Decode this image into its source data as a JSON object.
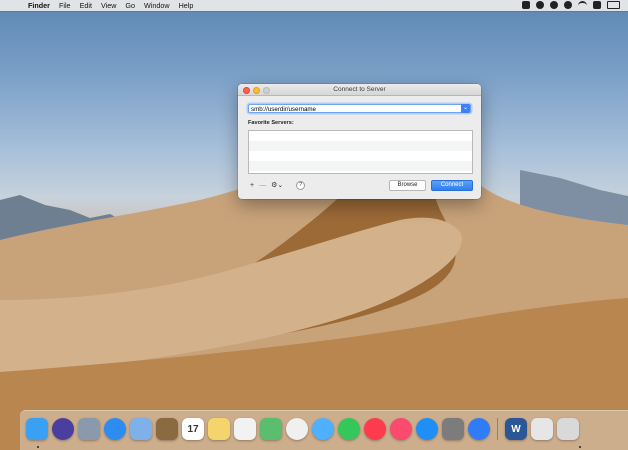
{
  "menubar": {
    "apple": "",
    "app_name": "Finder",
    "items": [
      "File",
      "Edit",
      "View",
      "Go",
      "Window",
      "Help"
    ]
  },
  "window": {
    "title": "Connect to Server",
    "server_address": "smb://userdir/username",
    "favorites_label": "Favorite Servers:",
    "add_label": "+",
    "remove_label": "—",
    "action_label": "⚙︎⌄",
    "help_label": "?",
    "browse_label": "Browse",
    "connect_label": "Connect"
  },
  "dock": {
    "apps": [
      {
        "name": "Finder",
        "color": "#3aa0f3"
      },
      {
        "name": "Siri",
        "color": "#4a3f9f"
      },
      {
        "name": "Launchpad",
        "color": "#8a9aac"
      },
      {
        "name": "Safari",
        "color": "#2d8cf0"
      },
      {
        "name": "Mail",
        "color": "#7fb0e8"
      },
      {
        "name": "Notes-Book",
        "color": "#8a6a40"
      },
      {
        "name": "Calendar",
        "color": "#ffffff",
        "text": "17"
      },
      {
        "name": "Notes",
        "color": "#f5d56b"
      },
      {
        "name": "Reminders",
        "color": "#f2f2f2"
      },
      {
        "name": "Maps",
        "color": "#5bbd6e"
      },
      {
        "name": "Photos",
        "color": "#f0f0f0"
      },
      {
        "name": "Messages",
        "color": "#4fb0ff"
      },
      {
        "name": "FaceTime",
        "color": "#35c759"
      },
      {
        "name": "News",
        "color": "#ff3b4f"
      },
      {
        "name": "Music",
        "color": "#fb4a6e"
      },
      {
        "name": "App Store",
        "color": "#1f8ff7"
      },
      {
        "name": "System Preferences",
        "color": "#7c7c7c"
      },
      {
        "name": "Xcode-Instruments",
        "color": "#2f7cf6"
      },
      {
        "name": "Word",
        "color": "#2b5797",
        "text": "W"
      },
      {
        "name": "Downloads",
        "color": "#e6e6e6"
      },
      {
        "name": "Trash",
        "color": "#d9d9d9"
      }
    ]
  }
}
